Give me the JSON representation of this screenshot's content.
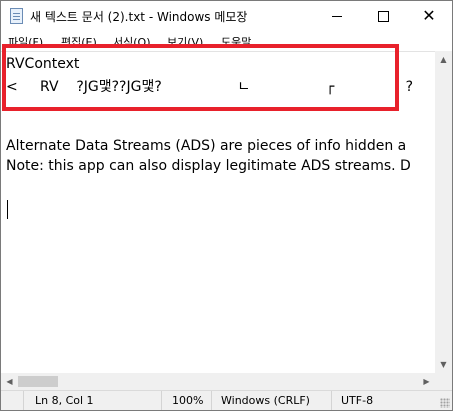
{
  "window": {
    "title": "새 텍스트 문서 (2).txt - Windows 메모장"
  },
  "menu": {
    "items": [
      "파일(F)",
      "편집(E)",
      "서식(O)",
      "보기(V)",
      "도움말"
    ]
  },
  "editor": {
    "lines": [
      "RVContext",
      "<     RV    ?JG맻??JG맻?                 ㄴ                 ┌                ?                ┐",
      "",
      "Alternate Data Streams (ADS) are pieces of info hidden a",
      "Note: this app can also display legitimate ADS streams. D",
      "",
      "",
      ""
    ],
    "highlighted_lines": [
      0,
      1
    ],
    "highlight_color": "#e8212b"
  },
  "statusbar": {
    "position": "Ln 8, Col 1",
    "zoom": "100%",
    "line_ending": "Windows (CRLF)",
    "encoding": "UTF-8"
  },
  "icons": {
    "app": "notepad-icon",
    "minimize": "minimize-icon",
    "maximize": "maximize-icon",
    "close": "close-icon"
  }
}
